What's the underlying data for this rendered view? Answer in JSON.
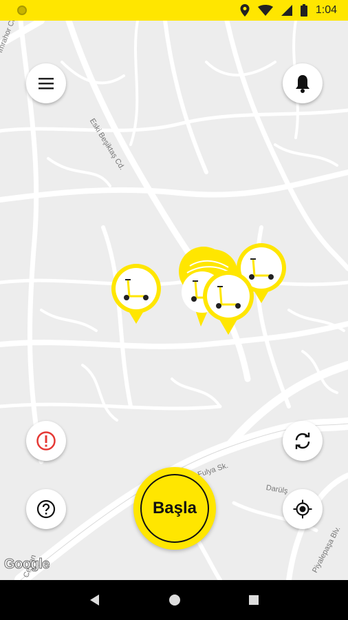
{
  "status_bar": {
    "time": "1:04"
  },
  "map": {
    "streets": [
      "İmrahor Cd.",
      "Eski Beşiktaş Cd.",
      "Fulya Sk.",
      "Darülş",
      "Piyalepaşa Blv.",
      "Ceylan"
    ],
    "attribution": "Google"
  },
  "controls": {
    "start_label": "Başla",
    "menu_icon": "menu-icon",
    "notification_icon": "bell-icon",
    "report_icon": "alert-icon",
    "help_icon": "help-icon",
    "refresh_icon": "refresh-icon",
    "locate_icon": "locate-icon"
  },
  "colors": {
    "brand": "#ffe600",
    "alert": "#e53935"
  }
}
